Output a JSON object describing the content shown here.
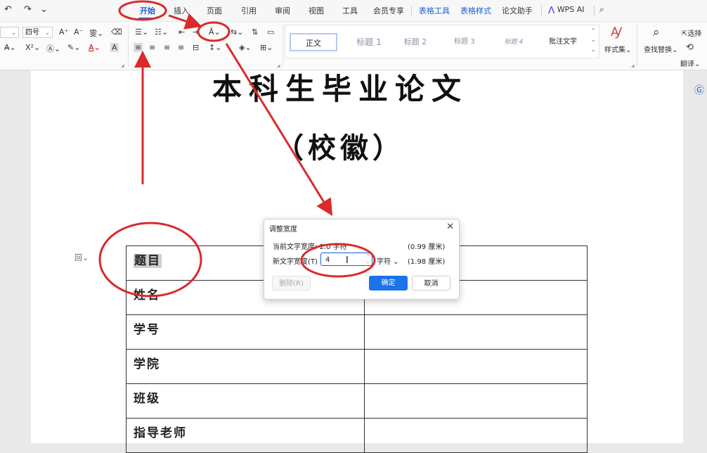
{
  "topbar": {
    "quick_access": [
      "↶",
      "↷",
      "⌄"
    ],
    "tabs": [
      {
        "label": "开始",
        "active": true
      },
      {
        "label": "插入"
      },
      {
        "label": "页面"
      },
      {
        "label": "引用"
      },
      {
        "label": "审阅"
      },
      {
        "label": "视图"
      },
      {
        "label": "工具"
      },
      {
        "label": "会员专享"
      },
      {
        "label": "表格工具"
      },
      {
        "label": "表格样式"
      },
      {
        "label": "论文助手"
      },
      {
        "label": "WPS AI"
      }
    ]
  },
  "ribbon": {
    "font_size": "四号",
    "styles": [
      "正文",
      "标题 1",
      "标题 2",
      "标题 3",
      "标题 4",
      "批注文字"
    ],
    "style_set": "样式集",
    "find_replace": "查找替换",
    "select": "选择",
    "translate": "翻译"
  },
  "document": {
    "title": "本科生毕业论文",
    "subtitle": "（校徽）",
    "rows": [
      "题目",
      "姓名",
      "学号",
      "学院",
      "班级",
      "指导老师"
    ]
  },
  "dialog": {
    "title": "调整宽度",
    "current_label": "当前文字宽度:",
    "current_value": "2.0 字符",
    "current_cm": "(0.99 厘米)",
    "new_label": "新文字宽度(T)",
    "new_value": "4",
    "unit": "字符",
    "new_cm": "(1.98 厘米)",
    "delete": "删除(R)",
    "ok": "确定",
    "cancel": "取消"
  },
  "colors": {
    "accent": "#1a5fd6",
    "annotation": "#d92b2b"
  }
}
